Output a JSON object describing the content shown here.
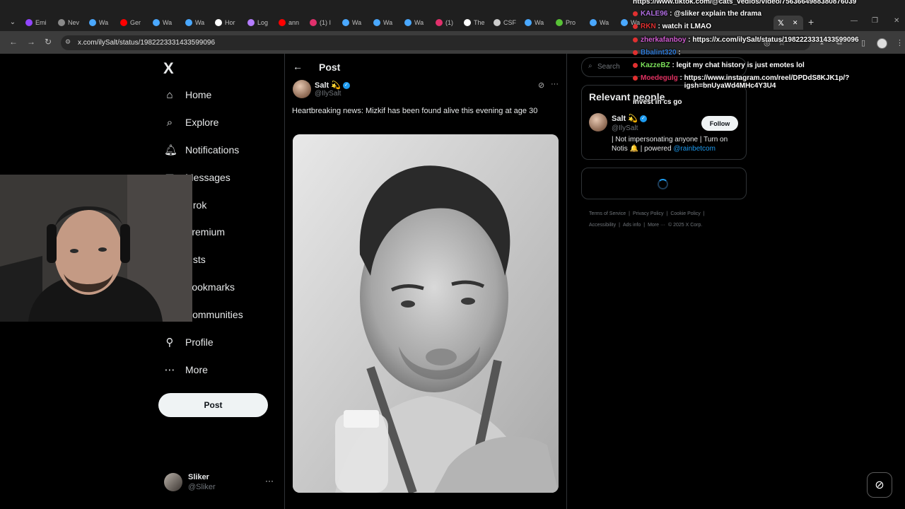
{
  "browser": {
    "tabs": [
      {
        "label": "Emi",
        "color": "#9146ff"
      },
      {
        "label": "Nev",
        "color": "#8a8a8a"
      },
      {
        "label": "Wa",
        "color": "#4aa8ff"
      },
      {
        "label": "Ger",
        "color": "#ff0000"
      },
      {
        "label": "Wa",
        "color": "#4aa8ff"
      },
      {
        "label": "Wa",
        "color": "#4aa8ff"
      },
      {
        "label": "Hor",
        "color": "#ffffff"
      },
      {
        "label": "Log",
        "color": "#b47cff"
      },
      {
        "label": "ann",
        "color": "#ff0000"
      },
      {
        "label": "(1) I",
        "color": "#e1306c"
      },
      {
        "label": "Wa",
        "color": "#4aa8ff"
      },
      {
        "label": "Wa",
        "color": "#4aa8ff"
      },
      {
        "label": "Wa",
        "color": "#4aa8ff"
      },
      {
        "label": "(1)",
        "color": "#e1306c"
      },
      {
        "label": "The",
        "color": "#ffffff"
      },
      {
        "label": "CSF",
        "color": "#cccccc"
      },
      {
        "label": "Wa",
        "color": "#4aa8ff"
      },
      {
        "label": "Pro",
        "color": "#58c236"
      },
      {
        "label": "Wa",
        "color": "#4aa8ff"
      },
      {
        "label": "Wa",
        "color": "#4aa8ff"
      }
    ],
    "url": "x.com/ilySalt/status/1982223331433599096"
  },
  "nav": {
    "logo": "X",
    "items": [
      {
        "label": "Home",
        "icon": "home-icon"
      },
      {
        "label": "Explore",
        "icon": "search-icon"
      },
      {
        "label": "Notifications",
        "icon": "bell-icon"
      },
      {
        "label": "Messages",
        "icon": "mail-icon"
      },
      {
        "label": "Grok",
        "icon": "grok-icon"
      },
      {
        "label": "Premium",
        "icon": "x-premium-icon"
      },
      {
        "label": "Lists",
        "icon": "list-icon"
      },
      {
        "label": "Bookmarks",
        "icon": "bookmark-icon"
      },
      {
        "label": "Communities",
        "icon": "communities-icon"
      },
      {
        "label": "Profile",
        "icon": "person-icon"
      },
      {
        "label": "More",
        "icon": "more-circle-icon"
      }
    ],
    "post_button": "Post",
    "account": {
      "name": "Sliker",
      "handle": "@Sliker"
    }
  },
  "main": {
    "title": "Post",
    "post": {
      "author_name": "Salt 💫",
      "handle": "@IlySalt",
      "text": "Heartbreaking news: Mizkif has been found alive this evening at age 30"
    }
  },
  "sidebar": {
    "search_placeholder": "Search",
    "relevant": {
      "title": "Relevant people",
      "name": "Salt 💫",
      "handle": "@IlySalt",
      "follow_label": "Follow",
      "bio_text": "| Not impersonating anyone | Turn on Notis 🔔 | powered ",
      "bio_link": "@rainbetcom"
    },
    "footer": [
      "Terms of Service",
      "|",
      "Privacy Policy",
      "|",
      "Cookie Policy",
      "|",
      "Accessibility",
      "|",
      "Ads info",
      "|",
      "More ···",
      "© 2025 X Corp."
    ]
  },
  "chat": {
    "lines": [
      {
        "user": "",
        "color": "#ffffff",
        "message": "https://www.tiktok.com/@cats_vedios/video/7563664988380876039"
      },
      {
        "user": "KALE96",
        "color": "#b06ee0",
        "message": "@sliker explain the drama"
      },
      {
        "user": "RKN",
        "color": "#e03030",
        "message": "watch it LMAO"
      },
      {
        "user": "zherkafanboy",
        "color": "#d15bd1",
        "message": "https://x.com/ilySalt/status/1982223331433599096"
      },
      {
        "user": "Bbalint320",
        "color": "#2f7bd8",
        "message": ""
      },
      {
        "user": "KazzeBZ",
        "color": "#7be05a",
        "message": "legit my chat history is just emotes lol"
      },
      {
        "user": "Moedegulg",
        "color": "#e03060",
        "message": "https://www.instagram.com/reel/DPDdS8KJK1p/?igsh=bnUyaWd4MHc4Y3U4"
      },
      {
        "user": "",
        "color": "#ffffff",
        "message": "invest in cs go"
      }
    ]
  }
}
